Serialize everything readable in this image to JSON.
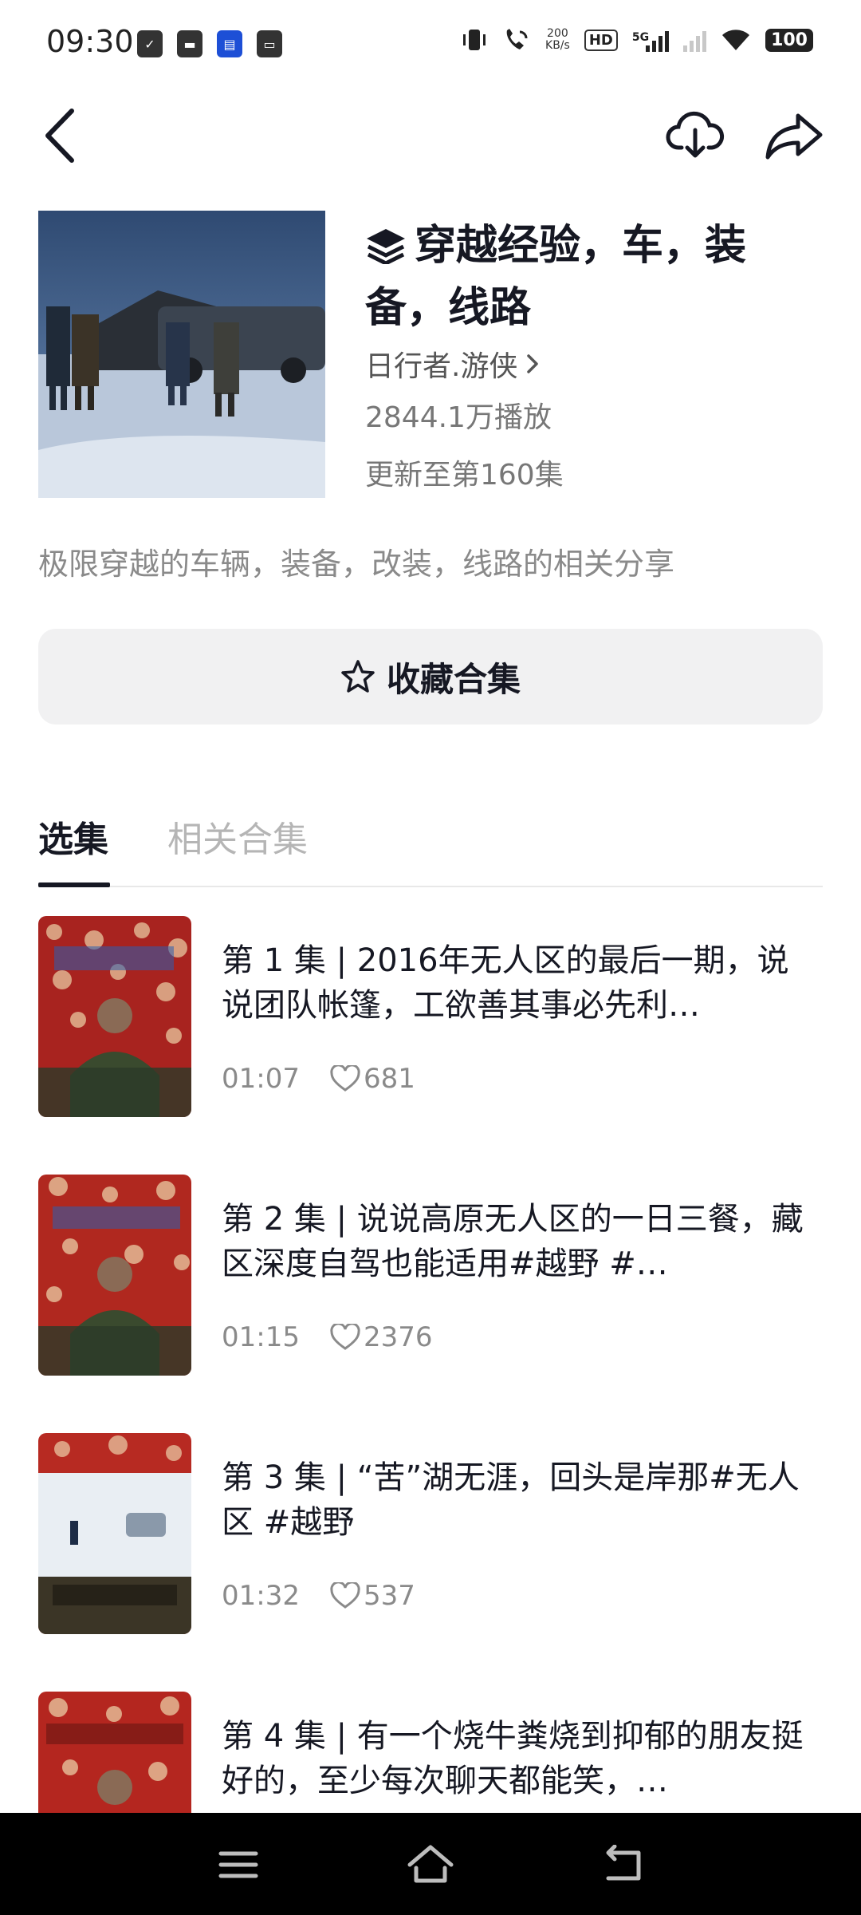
{
  "status_bar": {
    "time": "09:30",
    "speed_value": "200",
    "speed_unit": "KB/s",
    "hd": "HD",
    "network": "5G",
    "battery": "100"
  },
  "header": {
    "title": "穿越经验，车，装备，线路",
    "author": "日行者.游侠",
    "plays": "2844.1万播放",
    "update": "更新至第160集",
    "description": "极限穿越的车辆，装备，改装，线路的相关分享"
  },
  "collect_button": {
    "label": "收藏合集"
  },
  "tabs": [
    {
      "label": "选集",
      "active": true
    },
    {
      "label": "相关合集",
      "active": false
    }
  ],
  "episodes": [
    {
      "title": "第 1 集 | 2016年无人区的最后一期，说说团队帐篷，工欲善其事必先利…",
      "duration": "01:07",
      "likes": "681"
    },
    {
      "title": "第 2 集 | 说说高原无人区的一日三餐，藏区深度自驾也能适用#越野 #…",
      "duration": "01:15",
      "likes": "2376"
    },
    {
      "title": "第 3 集 | “苦”湖无涯，回头是岸那#无人区 #越野",
      "duration": "01:32",
      "likes": "537"
    },
    {
      "title": "第 4 集 | 有一个烧牛粪烧到抑郁的朋友挺好的，至少每次聊天都能笑，…",
      "duration": "",
      "likes": ""
    }
  ],
  "colors": {
    "text_primary": "#161823",
    "text_secondary": "#8a8a8a",
    "button_bg": "#f1f1f2",
    "system_nav_bg": "#000000"
  }
}
